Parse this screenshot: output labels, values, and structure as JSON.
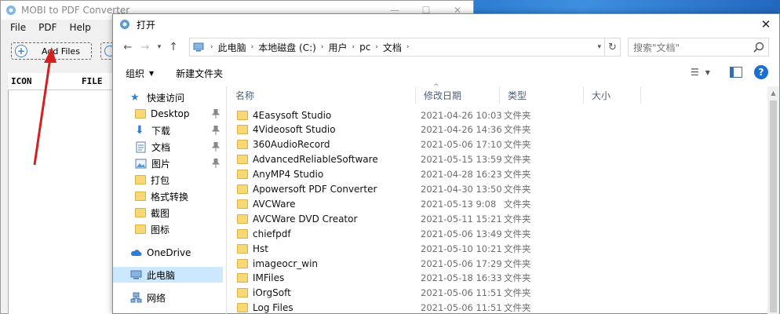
{
  "app": {
    "title": "MOBI to PDF Converter",
    "menu": [
      "File",
      "PDF",
      "Help"
    ],
    "add_files_label": "Add Files",
    "list_columns": [
      "ICON",
      "FILE"
    ]
  },
  "dialog": {
    "title": "打开",
    "breadcrumb": [
      "此电脑",
      "本地磁盘 (C:)",
      "用户",
      "pc",
      "文档"
    ],
    "search_placeholder": "搜索\"文档\"",
    "organize_label": "组织",
    "new_folder_label": "新建文件夹",
    "nav": {
      "quick_access": "快速访问",
      "items": [
        "Desktop",
        "下载",
        "文档",
        "图片",
        "打包",
        "格式转换",
        "截图",
        "图标"
      ],
      "onedrive": "OneDrive",
      "this_pc": "此电脑",
      "network": "网络"
    },
    "columns": {
      "name": "名称",
      "date": "修改日期",
      "type": "类型",
      "size": "大小"
    },
    "files": [
      {
        "name": "4Easysoft Studio",
        "date": "2021-04-26 10:03",
        "type": "文件夹"
      },
      {
        "name": "4Videosoft Studio",
        "date": "2021-04-26 14:36",
        "type": "文件夹"
      },
      {
        "name": "360AudioRecord",
        "date": "2021-05-06 17:10",
        "type": "文件夹"
      },
      {
        "name": "AdvancedReliableSoftware",
        "date": "2021-05-15 13:59",
        "type": "文件夹"
      },
      {
        "name": "AnyMP4 Studio",
        "date": "2021-04-28 16:23",
        "type": "文件夹"
      },
      {
        "name": "Apowersoft PDF Converter",
        "date": "2021-04-30 13:50",
        "type": "文件夹"
      },
      {
        "name": "AVCWare",
        "date": "2021-05-13 9:08",
        "type": "文件夹"
      },
      {
        "name": "AVCWare DVD Creator",
        "date": "2021-05-11 15:21",
        "type": "文件夹"
      },
      {
        "name": "chiefpdf",
        "date": "2021-05-06 13:49",
        "type": "文件夹"
      },
      {
        "name": "Hst",
        "date": "2021-05-10 10:21",
        "type": "文件夹"
      },
      {
        "name": "imageocr_win",
        "date": "2021-05-06 17:29",
        "type": "文件夹"
      },
      {
        "name": "IMFiles",
        "date": "2021-05-18 16:33",
        "type": "文件夹"
      },
      {
        "name": "iOrgSoft",
        "date": "2021-05-06 11:51",
        "type": "文件夹"
      },
      {
        "name": "Log Files",
        "date": "2021-05-06 11:51",
        "type": "文件夹"
      }
    ]
  },
  "colors": {
    "accent": "#1a6fd0",
    "selected": "#cce8ff",
    "folder": "#f8d775",
    "arrow": "#d42020"
  }
}
